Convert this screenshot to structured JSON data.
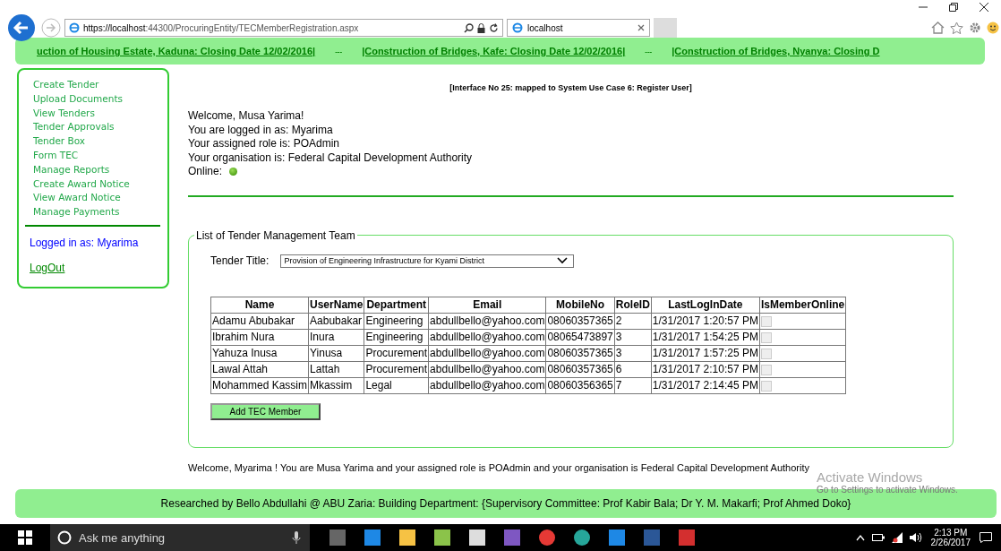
{
  "browser": {
    "address_host": "https://localhost",
    "address_rest": ":44300/ProcuringEntity/TECMemberRegistration.aspx",
    "tab_title": "localhost"
  },
  "ticker": [
    {
      "text": "uction of Housing Estate, Kaduna: Closing Date 12/02/2016|"
    },
    {
      "text": "---"
    },
    {
      "text": "|Construction of Bridges, Kafe: Closing Date 12/02/2016|"
    },
    {
      "text": "---"
    },
    {
      "text": "|Construction of Bridges, Nyanya: Closing D"
    }
  ],
  "sidebar": {
    "items": [
      "Create Tender",
      "Upload Documents",
      "View Tenders",
      "Tender Approvals",
      "Tender Box",
      "Form TEC",
      "Manage Reports",
      "Create Award Notice",
      "View Award Notice",
      "Manage Payments"
    ],
    "logged_in": "Logged in as: Myarima",
    "logout": "LogOut"
  },
  "interface_note": "[Interface No 25: mapped to System Use Case 6: Register User]",
  "welcome_lines": [
    "Welcome, Musa Yarima!",
    "You are logged in as: Myarima",
    "Your assigned role is: POAdmin",
    "Your organisation is: Federal Capital Development Authority"
  ],
  "online": {
    "label": "Online:",
    "on": true
  },
  "team_panel": {
    "legend": "List of Tender Management Team",
    "tender_label": "Tender Title:",
    "tender_value": "Provision of Engineering Infrastructure for Kyami District",
    "columns": [
      "Name",
      "UserName",
      "Department",
      "Email",
      "MobileNo",
      "RoleID",
      "LastLogInDate",
      "IsMemberOnline"
    ],
    "rows": [
      {
        "cells": [
          "Adamu Abubakar",
          "Aabubakar",
          "Engineering",
          "abdullbello@yahoo.com",
          "08060357365",
          "2",
          "1/31/2017 1:20:57 PM"
        ],
        "online": false
      },
      {
        "cells": [
          "Ibrahim Nura",
          "Inura",
          "Engineering",
          "abdullbello@yahoo.com",
          "08065473897",
          "3",
          "1/31/2017 1:54:25 PM"
        ],
        "online": false
      },
      {
        "cells": [
          "Yahuza Inusa",
          "Yinusa",
          "Procurement",
          "abdullbello@yahoo.com",
          "08060357365",
          "3",
          "1/31/2017 1:57:25 PM"
        ],
        "online": false
      },
      {
        "cells": [
          "Lawal Attah",
          "Lattah",
          "Procurement",
          "abdullbello@yahoo.com",
          "08060357365",
          "6",
          "1/31/2017 2:10:57 PM"
        ],
        "online": false
      },
      {
        "cells": [
          "Mohammed Kassim",
          "Mkassim",
          "Legal",
          "abdullbello@yahoo.com",
          "08060356365",
          "7",
          "1/31/2017 2:14:45 PM"
        ],
        "online": false
      }
    ],
    "add_button": "Add TEC Member"
  },
  "summary": "Welcome, Myarima ! You are Musa Yarima and your assigned role is POAdmin and your organisation is Federal Capital Development Authority",
  "footer": "Researched by Bello Abdullahi @ ABU Zaria: Building Department: {Supervisory Committee: Prof Kabir Bala; Dr Y. M. Makarfi; Prof Ahmed Doko}",
  "activation": {
    "title": "Activate Windows",
    "hint": "Go to Settings to activate Windows."
  },
  "taskbar": {
    "search_placeholder": "Ask me anything",
    "time": "2:13 PM",
    "date": "2/26/2017"
  }
}
